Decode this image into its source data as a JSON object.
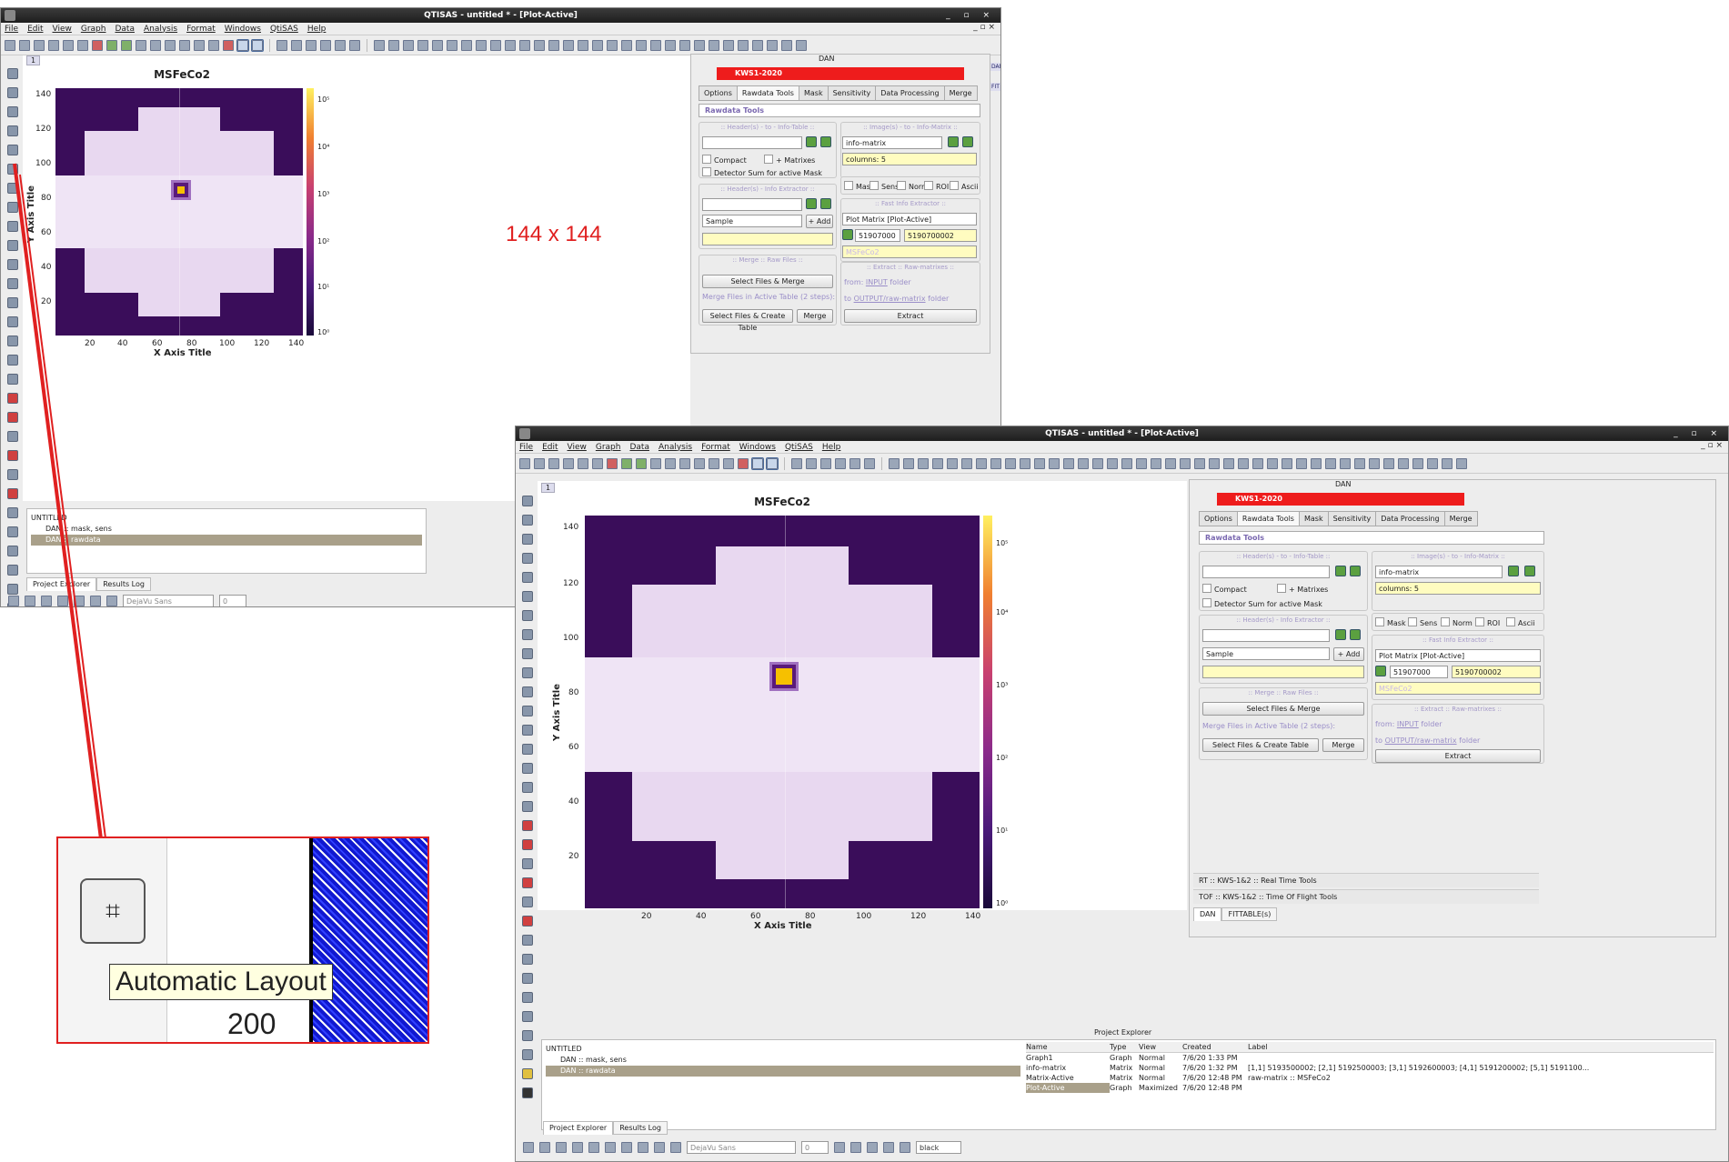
{
  "window_title": "QTISAS - untitled * - [Plot-Active]",
  "window_controls": "_ ▫ ×",
  "mdi_controls": "_ ▫ ×",
  "menu": [
    "File",
    "Edit",
    "View",
    "Graph",
    "Data",
    "Analysis",
    "Format",
    "Windows",
    "QtiSAS",
    "Help"
  ],
  "plot_tab": "1",
  "plot": {
    "title": "MSFeCo2",
    "xlabel": "X Axis Title",
    "ylabel": "Y Axis Title",
    "x_ticks": [
      "20",
      "40",
      "60",
      "80",
      "100",
      "120",
      "140"
    ],
    "y_ticks": [
      "140",
      "120",
      "100",
      "80",
      "60",
      "40",
      "20"
    ],
    "cbar_ticks": [
      "10⁵",
      "10⁴",
      "10³",
      "10²",
      "10¹",
      "10⁰"
    ]
  },
  "chart_data": {
    "type": "heatmap",
    "title": "MSFeCo2",
    "xlabel": "X Axis Title",
    "ylabel": "Y Axis Title",
    "xlim": [
      1,
      144
    ],
    "ylim": [
      1,
      144
    ],
    "color_scale": "log",
    "colorbar_range": [
      1,
      100000
    ],
    "colormap_colors": [
      "#1a0a3a",
      "#4a1a7a",
      "#8a2a8a",
      "#c84070",
      "#f08030",
      "#fff060"
    ],
    "beam_center_approx": [
      72,
      80
    ]
  },
  "annotation_size": "144 x 144",
  "tooltip": "Automatic Layout",
  "zoom_number": "200",
  "dan": {
    "panel_title": "DAN",
    "instrument": "KWS1-2020",
    "side_tabs": [
      "DAN",
      "FIT"
    ],
    "tabs": [
      "Options",
      "Rawdata Tools",
      "Mask",
      "Sensitivity",
      "Data Processing",
      "Merge"
    ],
    "section": "Rawdata Tools",
    "header_to_table": ":: Header(s) - to - Info-Table ::",
    "images_to_matrix": ":: Image(s) - to - Info-Matrix ::",
    "info_matrix": "info-matrix",
    "columns": "columns: 5",
    "compact": "Compact",
    "matrixes": "+ Matrixes",
    "detsum": "Detector Sum for active Mask",
    "checks": [
      "Mask",
      "Sens",
      "Norm",
      "ROI",
      "Ascii"
    ],
    "header_extractor": ":: Header(s) - Info Extractor ::",
    "fast_extractor": ":: Fast Info Extractor ::",
    "plot_matrix": "Plot Matrix [Plot-Active]",
    "sample": "Sample",
    "add": "+ Add",
    "run1": "51907000",
    "run2": "5190700002",
    "msfeco2": "MSFeCo2",
    "merge_raw": ":: Merge :: Raw Files ::",
    "extract_raw": ":: Extract :: Raw-matrixes ::",
    "select_merge": "Select Files  & Merge",
    "from_input_pre": "from: ",
    "from_input_link": "INPUT",
    "from_input_post": " folder",
    "merge_note": "Merge Files in Active Table (2 steps):",
    "to_output_pre": "to ",
    "to_output_link": "OUTPUT/raw-matrix",
    "to_output_post": " folder",
    "select_create": "Select Files & Create Table",
    "merge": "Merge",
    "extract": "Extract",
    "rt": "RT  :: KWS-1&2  :: Real Time Tools",
    "tof": "TOF :: KWS-1&2 :: Time Of Flight Tools",
    "bottom_tabs": [
      "DAN",
      "FITTABLE(s)"
    ]
  },
  "explorer": {
    "title": "Project Explorer",
    "tree": [
      "UNTITLED",
      "DAN :: mask, sens",
      "DAN :: rawdata"
    ],
    "headers": [
      "Name",
      "Type",
      "View",
      "Created",
      "Label"
    ],
    "rows": [
      {
        "name": "Graph1",
        "type": "Graph",
        "view": "Normal",
        "created": "7/6/20 1:33 PM",
        "label": ""
      },
      {
        "name": "info-matrix",
        "type": "Matrix",
        "view": "Normal",
        "created": "7/6/20 1:32 PM",
        "label": "[1,1] 5193500002; [2,1] 5192500003; [3,1] 5192600003; [4,1] 5191200002; [5,1] 5191100..."
      },
      {
        "name": "Matrix-Active",
        "type": "Matrix",
        "view": "Normal",
        "created": "7/6/20 12:48 PM",
        "label": "raw-matrix :: MSFeCo2"
      },
      {
        "name": "Plot-Active",
        "type": "Graph",
        "view": "Maximized",
        "created": "7/6/20 12:48 PM",
        "label": ""
      }
    ],
    "bottom_tabs": [
      "Project Explorer",
      "Results Log"
    ]
  },
  "statusbar": {
    "font": "DejaVu Sans",
    "size": "0",
    "color": "black"
  }
}
